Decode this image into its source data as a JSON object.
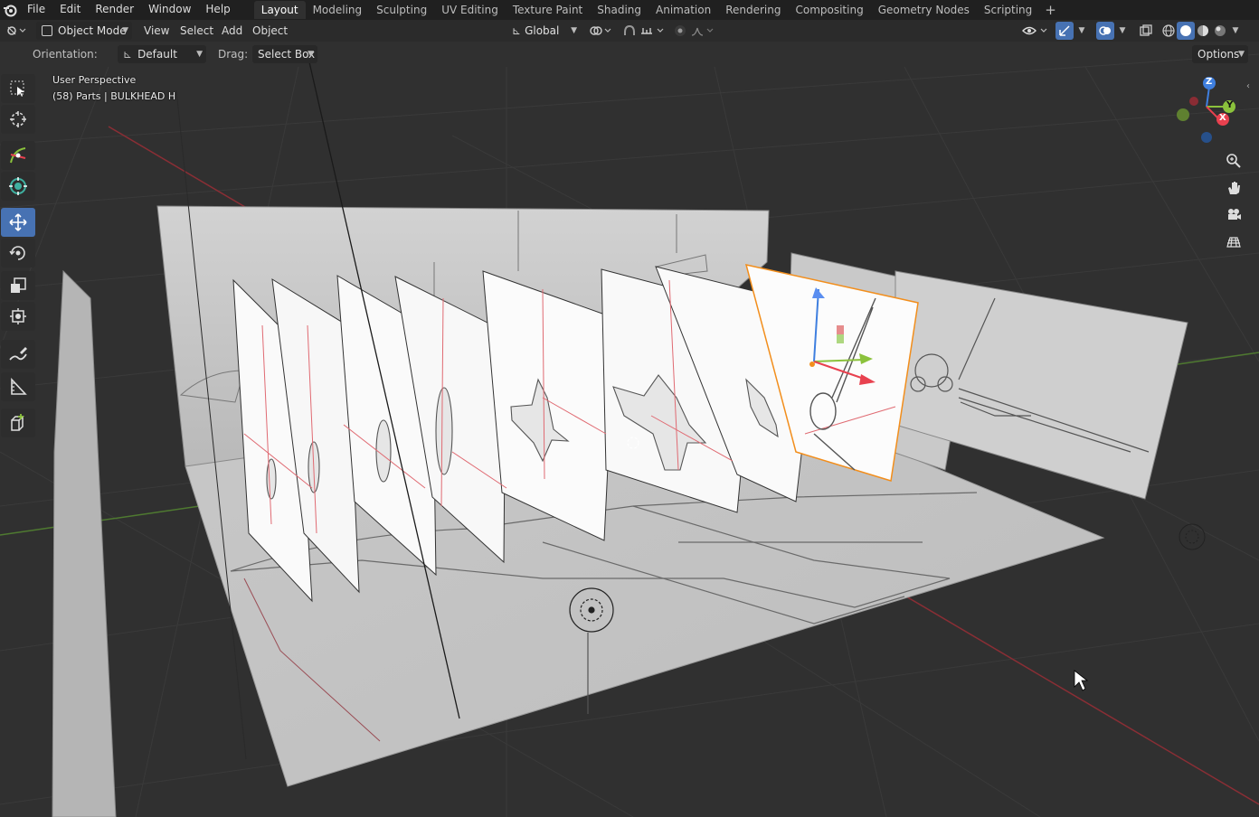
{
  "topbar": {
    "menus": [
      "File",
      "Edit",
      "Render",
      "Window",
      "Help"
    ],
    "workspaces": [
      "Layout",
      "Modeling",
      "Sculpting",
      "UV Editing",
      "Texture Paint",
      "Shading",
      "Animation",
      "Rendering",
      "Compositing",
      "Geometry Nodes",
      "Scripting"
    ],
    "active_workspace": "Layout",
    "add_tab": "+"
  },
  "header": {
    "mode": "Object Mode",
    "menus": [
      "View",
      "Select",
      "Add",
      "Object"
    ],
    "transform_orientation": "Global"
  },
  "toolsettings": {
    "orientation_label": "Orientation:",
    "orientation_value": "Default",
    "drag_label": "Drag:",
    "drag_value": "Select Box",
    "options_label": "Options"
  },
  "viewport": {
    "view_name": "User Perspective",
    "collection_info": "(58) Parts | BULKHEAD H",
    "gizmo_axes": {
      "x": "X",
      "y": "Y",
      "z": "Z"
    }
  },
  "tools": [
    "select-box-icon",
    "cursor-icon",
    "annotate-tweak-icon",
    "transform-pivot-icon",
    "move-icon",
    "rotate-icon",
    "scale-icon",
    "transform-icon",
    "annotate-icon",
    "measure-icon",
    "add-cube-icon"
  ],
  "colors": {
    "accent": "#4772b3",
    "axis_x": "#e8414f",
    "axis_y": "#8bc23c",
    "axis_z": "#3f7fdf",
    "selection": "#f28e1c"
  }
}
